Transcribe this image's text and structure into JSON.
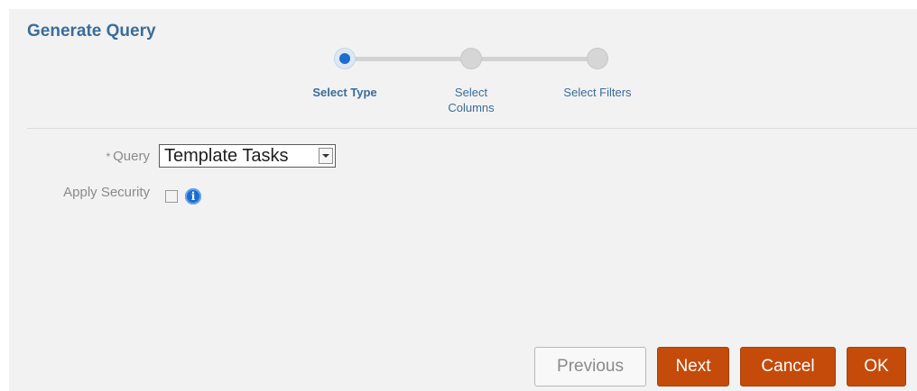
{
  "dialog": {
    "title": "Generate Query"
  },
  "train": {
    "steps": [
      {
        "label": "Select Type",
        "active": true
      },
      {
        "label_line1": "Select",
        "label_line2": "Columns",
        "active": false
      },
      {
        "label": "Select Filters",
        "active": false
      }
    ]
  },
  "form": {
    "query": {
      "required_marker": "*",
      "label": "Query",
      "value": "Template Tasks"
    },
    "apply_security": {
      "label": "Apply Security",
      "checked": false,
      "info_icon": "info-icon"
    }
  },
  "buttons": {
    "previous": "Previous",
    "next": "Next",
    "cancel": "Cancel",
    "ok": "OK"
  },
  "colors": {
    "title": "#3a6d99",
    "active_step": "#1b6dd1",
    "primary_button": "#c44b0a"
  }
}
